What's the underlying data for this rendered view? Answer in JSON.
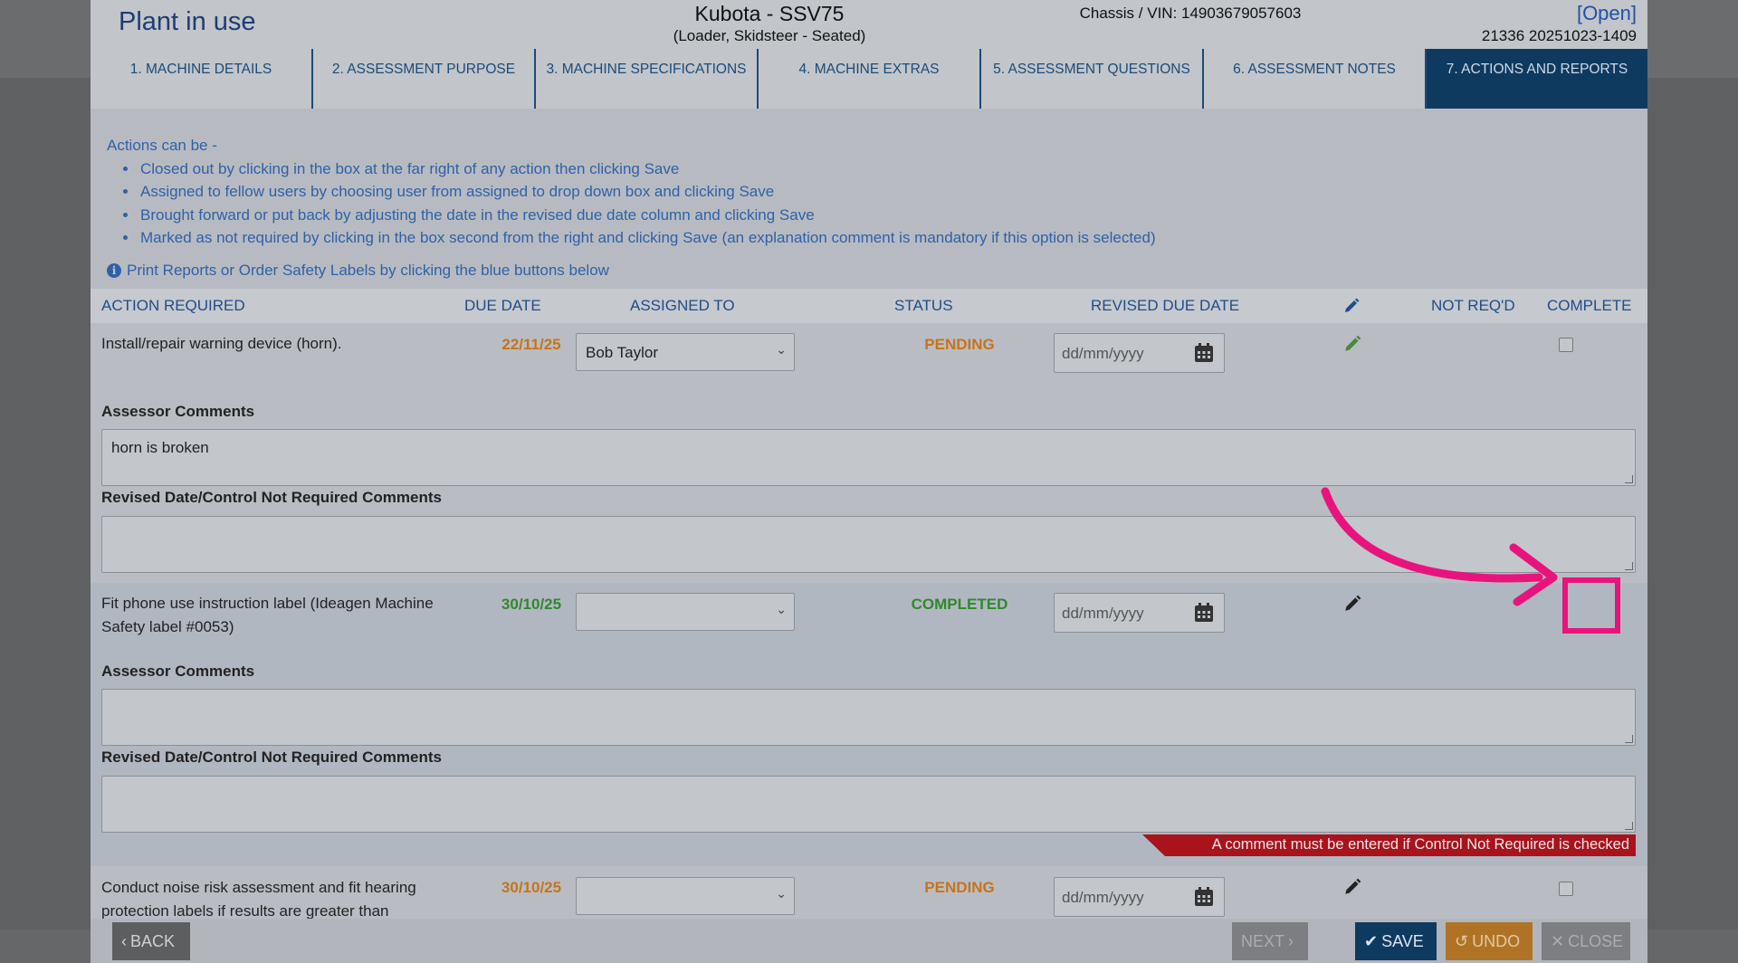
{
  "header": {
    "app_title": "Plant in use",
    "machine_name": "Kubota - SSV75",
    "machine_type": "(Loader, Skidsteer - Seated)",
    "chassis": "Chassis / VIN: 14903679057603",
    "open_label": "[Open]",
    "reference": "21336 20251023-1409"
  },
  "tabs": [
    {
      "label": "1. MACHINE DETAILS"
    },
    {
      "label": "2. ASSESSMENT PURPOSE"
    },
    {
      "label": "3. MACHINE SPECIFICATIONS"
    },
    {
      "label": "4. MACHINE EXTRAS"
    },
    {
      "label": "5. ASSESSMENT QUESTIONS"
    },
    {
      "label": "6. ASSESSMENT NOTES"
    },
    {
      "label": "7. ACTIONS AND REPORTS",
      "active": true
    }
  ],
  "instructions": {
    "intro": "Actions can be -",
    "items": [
      "Closed out by clicking in the box at the far right of any action then clicking Save",
      "Assigned to fellow users by choosing user from assigned to drop down box and clicking Save",
      "Brought forward or put back by adjusting the date in the revised due date column and clicking Save",
      "Marked as not required by clicking in the box second from the right and clicking Save (an explanation comment is mandatory if this option is selected)"
    ],
    "print_info": "Print Reports or Order Safety Labels by clicking the blue buttons below"
  },
  "columns": {
    "action_required": "ACTION REQUIRED",
    "due_date": "DUE DATE",
    "assigned_to": "ASSIGNED TO",
    "status": "STATUS",
    "revised_due_date": "REVISED DUE DATE",
    "edit_icon": "pencil-icon",
    "not_reqd": "NOT REQ'D",
    "complete": "COMPLETE"
  },
  "actions": [
    {
      "text": "Install/repair warning device (horn).",
      "due_date": "22/11/25",
      "due_color": "#c6741b",
      "assigned_to": "Bob Taylor",
      "status": "PENDING",
      "revised_placeholder": "dd/mm/yyyy",
      "not_reqd": false,
      "complete": false,
      "assessor_label": "Assessor Comments",
      "assessor_comment": "horn is broken",
      "revised_label": "Revised Date/Control Not Required Comments",
      "revised_comment": ""
    },
    {
      "text": "Fit phone use instruction label (Ideagen Machine Safety label #0053)",
      "due_date": "30/10/25",
      "due_color": "#2f8a2a",
      "assigned_to": "",
      "status": "COMPLETED",
      "revised_placeholder": "dd/mm/yyyy",
      "not_reqd": false,
      "complete": true,
      "assessor_label": "Assessor Comments",
      "assessor_comment": "",
      "revised_label": "Revised Date/Control Not Required Comments",
      "revised_comment": "",
      "error": "A comment must be entered if Control Not Required is checked"
    },
    {
      "text": "Conduct noise risk assessment and fit hearing protection labels if results are greater than",
      "due_date": "30/10/25",
      "due_color": "#c6741b",
      "assigned_to": "",
      "status": "PENDING",
      "revised_placeholder": "dd/mm/yyyy",
      "not_reqd": false,
      "complete": false
    }
  ],
  "footer": {
    "back": "BACK",
    "next": "NEXT",
    "save": "SAVE",
    "undo": "UNDO",
    "close": "CLOSE"
  },
  "colors": {
    "accent_navy": "#0e3a60",
    "link_blue": "#2f61a8",
    "pending": "#c6741b",
    "completed": "#2f8a2a",
    "error": "#a8131c",
    "highlight": "#e8147d"
  }
}
